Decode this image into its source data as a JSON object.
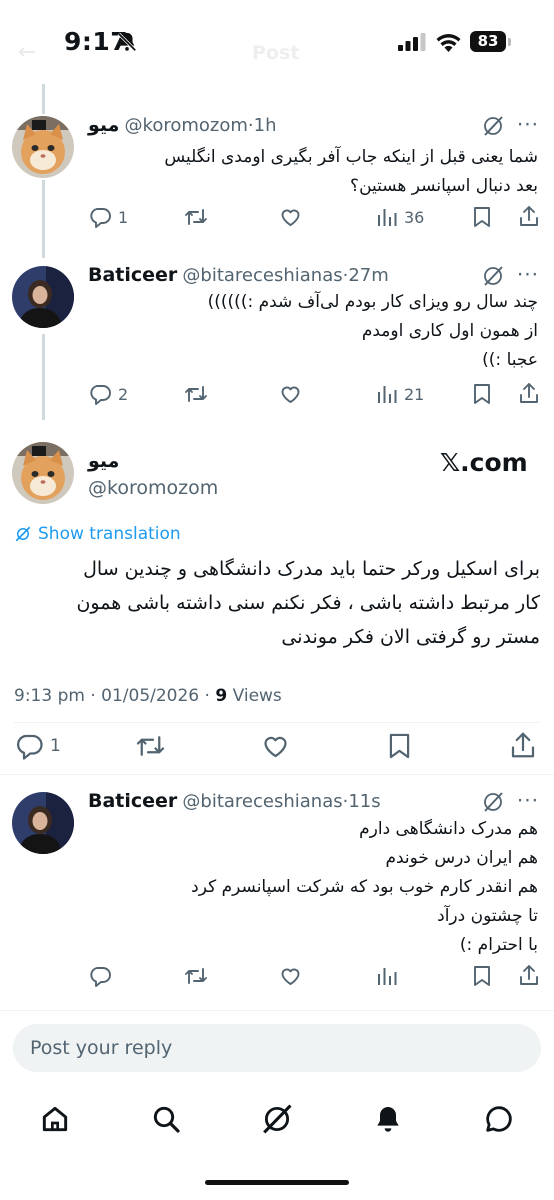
{
  "status_bar": {
    "time": "9:17",
    "battery": "83"
  },
  "header": {
    "title": "Post"
  },
  "replies_above": [
    {
      "name": "میو",
      "handle": "@koromozom",
      "age": "1h",
      "lines": [
        "شما یعنی قبل از اینکه جاب آفر بگیری اومدی انگلیس",
        "بعد دنبال اسپانسر هستین؟"
      ],
      "counts": {
        "reply": "1",
        "retweet": "",
        "like": "",
        "views": "36"
      }
    },
    {
      "name": "Baticeer",
      "handle": "@bitareceshianas",
      "age": "27m",
      "lines": [
        "چند سال رو ویزای کار بودم لی‌آف شدم :))))))",
        "از همون اول کاری اومدم",
        "عجبا :))"
      ],
      "counts": {
        "reply": "2",
        "retweet": "",
        "like": "",
        "views": "21"
      }
    }
  ],
  "main_post": {
    "name": "میو",
    "handle": "@koromozom",
    "watermark": "𝕏.com",
    "show_translation": "Show translation",
    "lines": [
      "برای اسکیل ورکر حتما باید مدرک دانشگاهی و چندین سال",
      "کار مرتبط داشته باشی ، فکر نکنم سنی داشته باشی همون",
      "مستر رو گرفتی الان فکر موندنی"
    ],
    "timestamp": "9:13 pm · 01/05/2026 · ",
    "views_count": "9",
    "views_label": " Views",
    "counts": {
      "reply": "1"
    }
  },
  "reply_below": {
    "name": "Baticeer",
    "handle": "@bitareceshianas",
    "age": "11s",
    "lines": [
      "هم مدرک دانشگاهی دارم",
      "هم ایران درس خوندم",
      "هم انقدر کارم خوب بود که شرکت اسپانسرم کرد",
      "تا چشتون درآد",
      "با احترام :)"
    ]
  },
  "composer": {
    "placeholder": "Post your reply"
  },
  "colors": {
    "accent": "#1d9bf0",
    "text": "#0f1419",
    "secondary": "#536471",
    "divider": "#eff3f4"
  },
  "icons": [
    "bell-off-icon",
    "signal-icon",
    "wifi-icon",
    "grok-icon",
    "more-icon",
    "reply-icon",
    "retweet-icon",
    "like-icon",
    "views-icon",
    "bookmark-icon",
    "share-icon",
    "translate-icon",
    "home-icon",
    "search-icon",
    "bell-icon",
    "messages-icon"
  ]
}
